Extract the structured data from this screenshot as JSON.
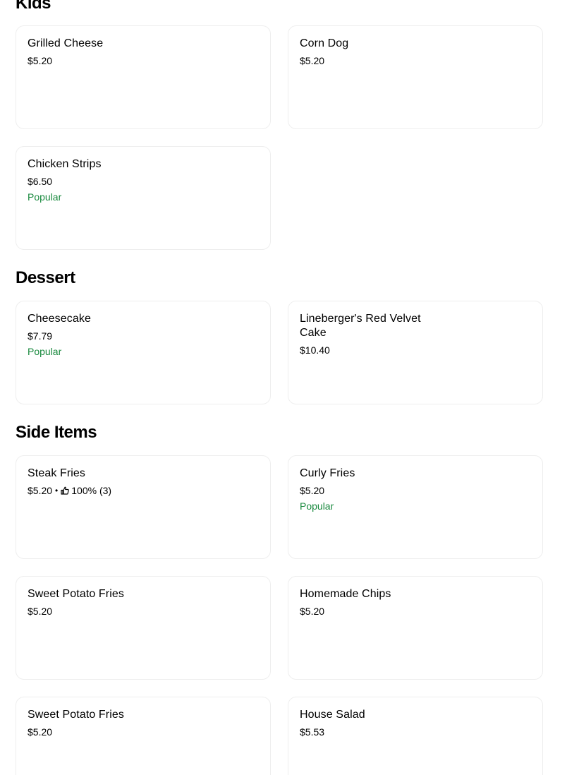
{
  "sections": [
    {
      "title": "Kids",
      "items": [
        {
          "name": "Grilled Cheese",
          "price": "$5.20"
        },
        {
          "name": "Corn Dog",
          "price": "$5.20"
        },
        {
          "name": "Chicken Strips",
          "price": "$6.50",
          "badge": "Popular"
        }
      ]
    },
    {
      "title": "Dessert",
      "items": [
        {
          "name": "Cheesecake",
          "price": "$7.79",
          "badge": "Popular"
        },
        {
          "name": "Lineberger's Red Velvet Cake",
          "price": "$10.40"
        }
      ]
    },
    {
      "title": "Side Items",
      "items": [
        {
          "name": "Steak Fries",
          "price": "$5.20",
          "separator": "•",
          "rating": "100% (3)",
          "rating_icon": "thumbs-up-icon"
        },
        {
          "name": "Curly Fries",
          "price": "$5.20",
          "badge": "Popular"
        },
        {
          "name": "Sweet Potato Fries",
          "price": "$5.20"
        },
        {
          "name": "Homemade Chips",
          "price": "$5.20"
        },
        {
          "name": "Sweet Potato Fries",
          "price": "$5.20"
        },
        {
          "name": "House Salad",
          "price": "$5.53"
        }
      ]
    }
  ],
  "colors": {
    "popular": "#1a8a3f",
    "card_border": "#eeeeee"
  }
}
